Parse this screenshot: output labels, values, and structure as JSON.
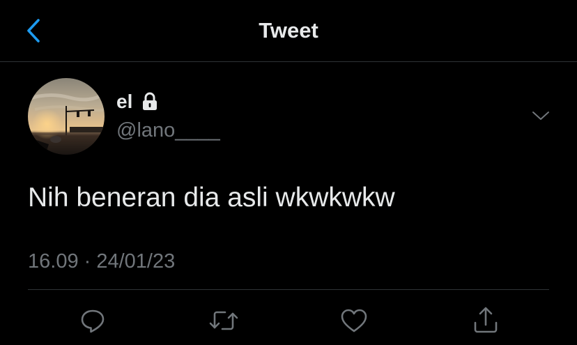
{
  "header": {
    "title": "Tweet",
    "back_icon": "chevron-left-icon"
  },
  "author": {
    "display_name": "el",
    "handle": "@lano____",
    "protected": true,
    "lock_icon": "lock-icon"
  },
  "tweet": {
    "text": "Nih beneran dia asli wkwkwkw",
    "timestamp": "16.09 · 24/01/23"
  },
  "actions": [
    {
      "icon": "reply-icon"
    },
    {
      "icon": "retweet-icon"
    },
    {
      "icon": "like-icon"
    },
    {
      "icon": "share-icon"
    }
  ],
  "colors": {
    "background": "#000000",
    "text_primary": "#e7e9ea",
    "text_secondary": "#71767b",
    "accent": "#1d9bf0",
    "divider": "#2f3336"
  }
}
